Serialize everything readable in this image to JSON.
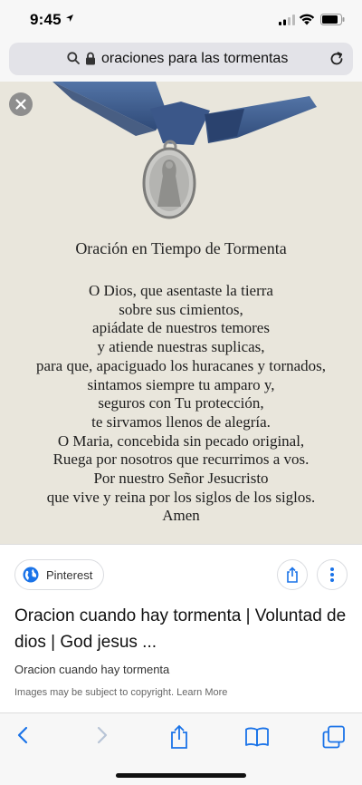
{
  "status_bar": {
    "time": "9:45"
  },
  "browser": {
    "url_text": "oraciones para las tormentas"
  },
  "image": {
    "title": "Oración en Tiempo de Tormenta",
    "lines": [
      "O Dios, que asentaste la tierra",
      "sobre sus cimientos,",
      "apiádate de nuestros temores",
      "y atiende nuestras suplicas,",
      "para que, apaciguado los huracanes y tornados,",
      "sintamos siempre tu amparo y,",
      "seguros con Tu protección,",
      "te sirvamos llenos de alegría.",
      "O Maria, concebida sin pecado original,",
      "Ruega por nosotros que recurrimos a vos.",
      "Por nuestro Señor Jesucristo",
      "que vive y reina por los siglos de los siglos.",
      "Amen"
    ]
  },
  "result": {
    "source": "Pinterest",
    "title": "Oracion cuando hay tormenta | Voluntad de dios | God jesus ...",
    "description": "Oracion cuando hay tormenta",
    "copyright_notice": "Images may be subject to copyright. Learn More"
  },
  "toolbar": {
    "items": [
      "back-icon",
      "forward-icon",
      "share-icon",
      "bookmarks-icon",
      "tabs-icon"
    ],
    "accent": "#1a73e8"
  },
  "colors": {
    "ribbon": "#3f5a8a",
    "image_bg": "#e9e6dc",
    "globe": "#1a73e8"
  }
}
